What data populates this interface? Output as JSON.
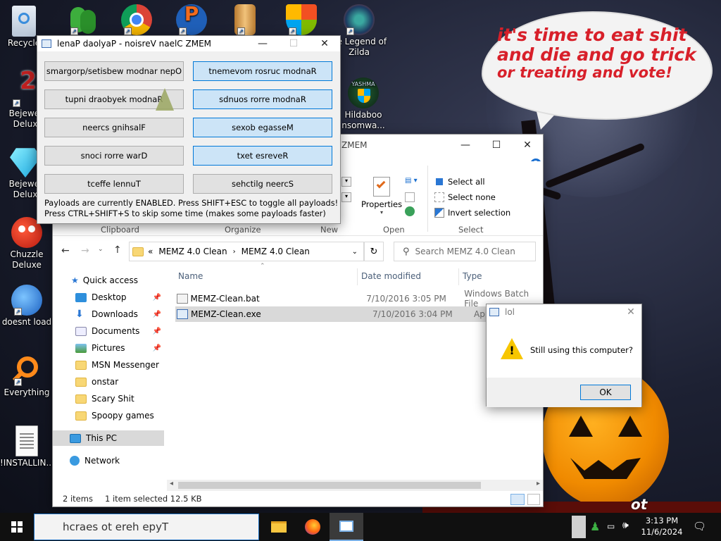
{
  "wallpaper": {
    "speech_line1": "it's time to eat shit",
    "speech_line2": "and die and go trick",
    "speech_line3": "or treating and vote!",
    "corner_text": "ot"
  },
  "desktop_icons": [
    {
      "label": "Recycle",
      "icon": "recycle-bin-icon"
    },
    {
      "label": "Bejewel Delux",
      "icon": "bejeweled-icon"
    },
    {
      "label": "Bejewel Delux",
      "icon": "bejeweled-diamond-icon"
    },
    {
      "label": "Chuzzle Deluxe",
      "icon": "chuzzle-icon"
    },
    {
      "label": "doesnt load",
      "icon": "thunderbird-icon"
    },
    {
      "label": "Everything",
      "icon": "everything-search-icon"
    },
    {
      "label": "!INSTALLIN...",
      "icon": "text-file-icon"
    },
    {
      "label": "he Legend of Zilda",
      "icon": "zelda-game-icon"
    },
    {
      "label": "Hildaboo nsomwa...",
      "icon": "hildaboo-shield-icon"
    }
  ],
  "memz_window": {
    "title": "lenaP daolyaP - noisreV naelC ZMEM",
    "buttons": [
      {
        "label": "smargorp/setisbew modnar nepO",
        "active": false
      },
      {
        "label": "tnemevom rosruc modnaR",
        "active": true
      },
      {
        "label": "tupni draobyek modnaR",
        "active": false
      },
      {
        "label": "sdnuos rorre modnaR",
        "active": true
      },
      {
        "label": "neercs gnihsalF",
        "active": false
      },
      {
        "label": "sexob egasseM",
        "active": true
      },
      {
        "label": "snoci rorre warD",
        "active": false
      },
      {
        "label": "txet esreveR",
        "active": true
      },
      {
        "label": "tceffe lennuT",
        "active": false
      },
      {
        "label": "sehctilg neercS",
        "active": false
      }
    ],
    "status_line1": "Payloads are currently ENABLED. Press SHIFT+ESC to toggle all payloads!",
    "status_line2": "Press CTRL+SHIFT+S to skip some time (makes some payloads faster)"
  },
  "explorer": {
    "title": "ZMEM",
    "ribbon": {
      "properties_label": "Properties",
      "select_all": "Select all",
      "select_none": "Select none",
      "invert_selection": "Invert selection",
      "groups": [
        "Clipboard",
        "Organize",
        "New",
        "Open",
        "Select"
      ]
    },
    "breadcrumb": [
      "MEMZ 4.0 Clean",
      "MEMZ 4.0 Clean"
    ],
    "breadcrumb_prefix": "«",
    "search_placeholder": "Search MEMZ 4.0 Clean",
    "nav": {
      "quick_access": "Quick access",
      "items": [
        "Desktop",
        "Downloads",
        "Documents",
        "Pictures",
        "MSN Messenger",
        "onstar",
        "Scary Shit",
        "Spoopy games"
      ],
      "this_pc": "This PC",
      "network": "Network"
    },
    "columns": [
      "Name",
      "Date modified",
      "Type"
    ],
    "files": [
      {
        "name": "MEMZ-Clean.bat",
        "date": "7/10/2016 3:05 PM",
        "type": "Windows Batch File",
        "selected": false
      },
      {
        "name": "MEMZ-Clean.exe",
        "date": "7/10/2016 3:04 PM",
        "type": "Applic",
        "selected": true
      }
    ],
    "status_items": "2 items",
    "status_selected": "1 item selected  12.5 KB"
  },
  "lol_dialog": {
    "title": "lol",
    "message": "Still using this computer?",
    "ok_label": "OK"
  },
  "taskbar": {
    "search_text": "hcraes ot ereh epyT",
    "time": "3:13 PM",
    "date": "11/6/2024"
  }
}
